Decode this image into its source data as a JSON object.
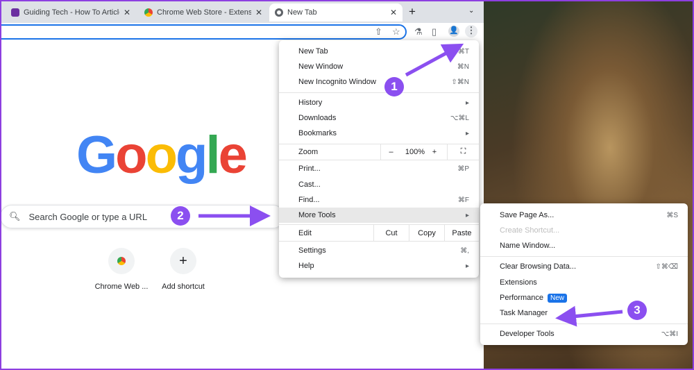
{
  "tabs": [
    {
      "label": "Guiding Tech - How To Articles",
      "favicon": "gt-logo"
    },
    {
      "label": "Chrome Web Store - Extensions",
      "favicon": "webstore-icon"
    },
    {
      "label": "New Tab",
      "favicon": "chrome-icon",
      "active": true
    }
  ],
  "new_tab_label": "+",
  "google_logo": [
    "G",
    "o",
    "o",
    "g",
    "l",
    "e"
  ],
  "logo_colors": [
    "#4285f4",
    "#ea4335",
    "#fbbc05",
    "#4285f4",
    "#34a853",
    "#ea4335"
  ],
  "search": {
    "placeholder": "Search Google or type a URL"
  },
  "shortcuts": [
    {
      "label": "Chrome Web ..."
    },
    {
      "label": "Add shortcut",
      "icon": "+"
    }
  ],
  "menu": {
    "new_tab": {
      "label": "New Tab",
      "shortcut": "⌘T"
    },
    "new_window": {
      "label": "New Window",
      "shortcut": "⌘N"
    },
    "incognito": {
      "label": "New Incognito Window",
      "shortcut": "⇧⌘N"
    },
    "history": {
      "label": "History",
      "arrow": "▸"
    },
    "downloads": {
      "label": "Downloads",
      "shortcut": "⌥⌘L"
    },
    "bookmarks": {
      "label": "Bookmarks",
      "arrow": "▸"
    },
    "zoom": {
      "label": "Zoom",
      "minus": "–",
      "value": "100%",
      "plus": "+",
      "fullscreen": "⛶"
    },
    "print": {
      "label": "Print...",
      "shortcut": "⌘P"
    },
    "cast": {
      "label": "Cast..."
    },
    "find": {
      "label": "Find...",
      "shortcut": "⌘F"
    },
    "more_tools": {
      "label": "More Tools",
      "arrow": "▸"
    },
    "edit": {
      "label": "Edit",
      "cut": "Cut",
      "copy": "Copy",
      "paste": "Paste"
    },
    "settings": {
      "label": "Settings",
      "shortcut": "⌘,"
    },
    "help": {
      "label": "Help",
      "arrow": "▸"
    }
  },
  "submenu": {
    "save_page": {
      "label": "Save Page As...",
      "shortcut": "⌘S"
    },
    "create_shortcut": {
      "label": "Create Shortcut..."
    },
    "name_window": {
      "label": "Name Window..."
    },
    "clear_data": {
      "label": "Clear Browsing Data...",
      "shortcut": "⇧⌘⌫"
    },
    "extensions": {
      "label": "Extensions"
    },
    "performance": {
      "label": "Performance",
      "badge": "New"
    },
    "task_manager": {
      "label": "Task Manager"
    },
    "dev_tools": {
      "label": "Developer Tools",
      "shortcut": "⌥⌘I"
    }
  },
  "annotations": [
    "1",
    "2",
    "3"
  ],
  "accent": "#8b4ff0"
}
